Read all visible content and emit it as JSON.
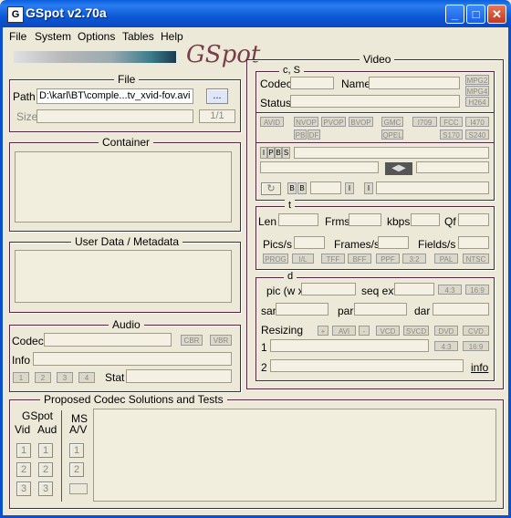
{
  "window": {
    "title": "GSpot v2.70a",
    "icon_text": "G"
  },
  "menu": [
    "File",
    "System",
    "Options",
    "Tables",
    "Help"
  ],
  "logo_text": "GSpot",
  "file_group": {
    "label": "File",
    "path_label": "Path",
    "path_value": "D:\\karl\\BT\\comple...tv_xvid-fov.avi",
    "browse_label": "...",
    "size_label": "Size",
    "counter": "1/1"
  },
  "container_group": {
    "label": "Container"
  },
  "userdata_group": {
    "label": "User Data / Metadata"
  },
  "audio_group": {
    "label": "Audio",
    "codec_label": "Codec",
    "info_label": "Info",
    "cbr": "CBR",
    "vbr": "VBR",
    "stream_buttons": [
      "1",
      "2",
      "3",
      "4"
    ],
    "stat_label": "Stat"
  },
  "video_group": {
    "label": "Video",
    "cs_label": "c, S",
    "codec_label": "Codec",
    "name_label": "Name",
    "status_label": "Status",
    "mpeg_tags": [
      "MPG2",
      "MPG4",
      "H264"
    ],
    "feature_tags": [
      "AVID",
      "NVOP",
      "PVOP",
      "BVOP",
      "GMC",
      "I709",
      "FCC",
      "I470",
      "PB",
      "DF",
      "QPEL",
      "S170",
      "S240"
    ],
    "frame_tags": [
      "I",
      "P",
      "B",
      "S"
    ],
    "pb_tags": [
      "B",
      "B"
    ],
    "i_tags": [
      "I",
      "I"
    ],
    "t_label": "t",
    "len_label": "Len",
    "frms_label": "Frms",
    "kbps_label": "kbps",
    "qf_label": "Qf",
    "pics_label": "Pics/s",
    "frames_label": "Frames/s",
    "fields_label": "Fields/s",
    "scan_tags": [
      "PROG",
      "I/L",
      "TFF",
      "BFF",
      "PPF",
      "3:2",
      "PAL",
      "NTSC"
    ],
    "d_label": "d",
    "pic_label": "pic (w x",
    "seq_label": "seq ext",
    "ar_tags": [
      "4:3",
      "16:9"
    ],
    "sar_label": "sar",
    "par_label": "par",
    "dar_label": "dar",
    "resizing_label": "Resizing",
    "resize_tags": [
      "+",
      "AVI",
      "-",
      "VCD",
      "SVCD",
      "DVD",
      "CVD"
    ],
    "row1_label": "1",
    "row2_label": "2",
    "row1_ar_tags": [
      "4:3",
      "16:9"
    ],
    "info_link": "info"
  },
  "proposed_group": {
    "label": "Proposed Codec Solutions and Tests",
    "gspot_label": "GSpot",
    "vid_label": "Vid",
    "aud_label": "Aud",
    "ms_label": "MS",
    "av_label": "A/V",
    "buttons": [
      "1",
      "2",
      "3"
    ]
  }
}
